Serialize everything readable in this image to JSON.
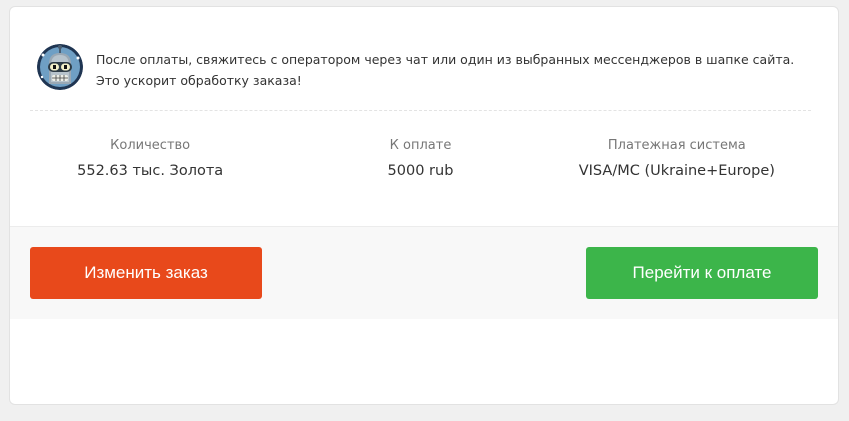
{
  "notice": {
    "avatar_icon": "bender-robot-avatar",
    "line1": "После оплаты, свяжитесь с оператором через чат или один из выбранных мессенджеров в шапке сайта.",
    "line2": "Это ускорит обработку заказа!"
  },
  "summary": {
    "items": [
      {
        "label": "Количество",
        "value": "552.63 тыс. Золота"
      },
      {
        "label": "К оплате",
        "value": "5000 rub"
      },
      {
        "label": "Платежная система",
        "value": "VISA/MC (Ukraine+Europe)"
      }
    ]
  },
  "actions": {
    "edit_label": "Изменить заказ",
    "pay_label": "Перейти к оплате"
  },
  "colors": {
    "edit_button": "#e8491b",
    "pay_button": "#3cb54a",
    "page_bg": "#f0f0f0",
    "footer_bg": "#f8f8f8"
  }
}
